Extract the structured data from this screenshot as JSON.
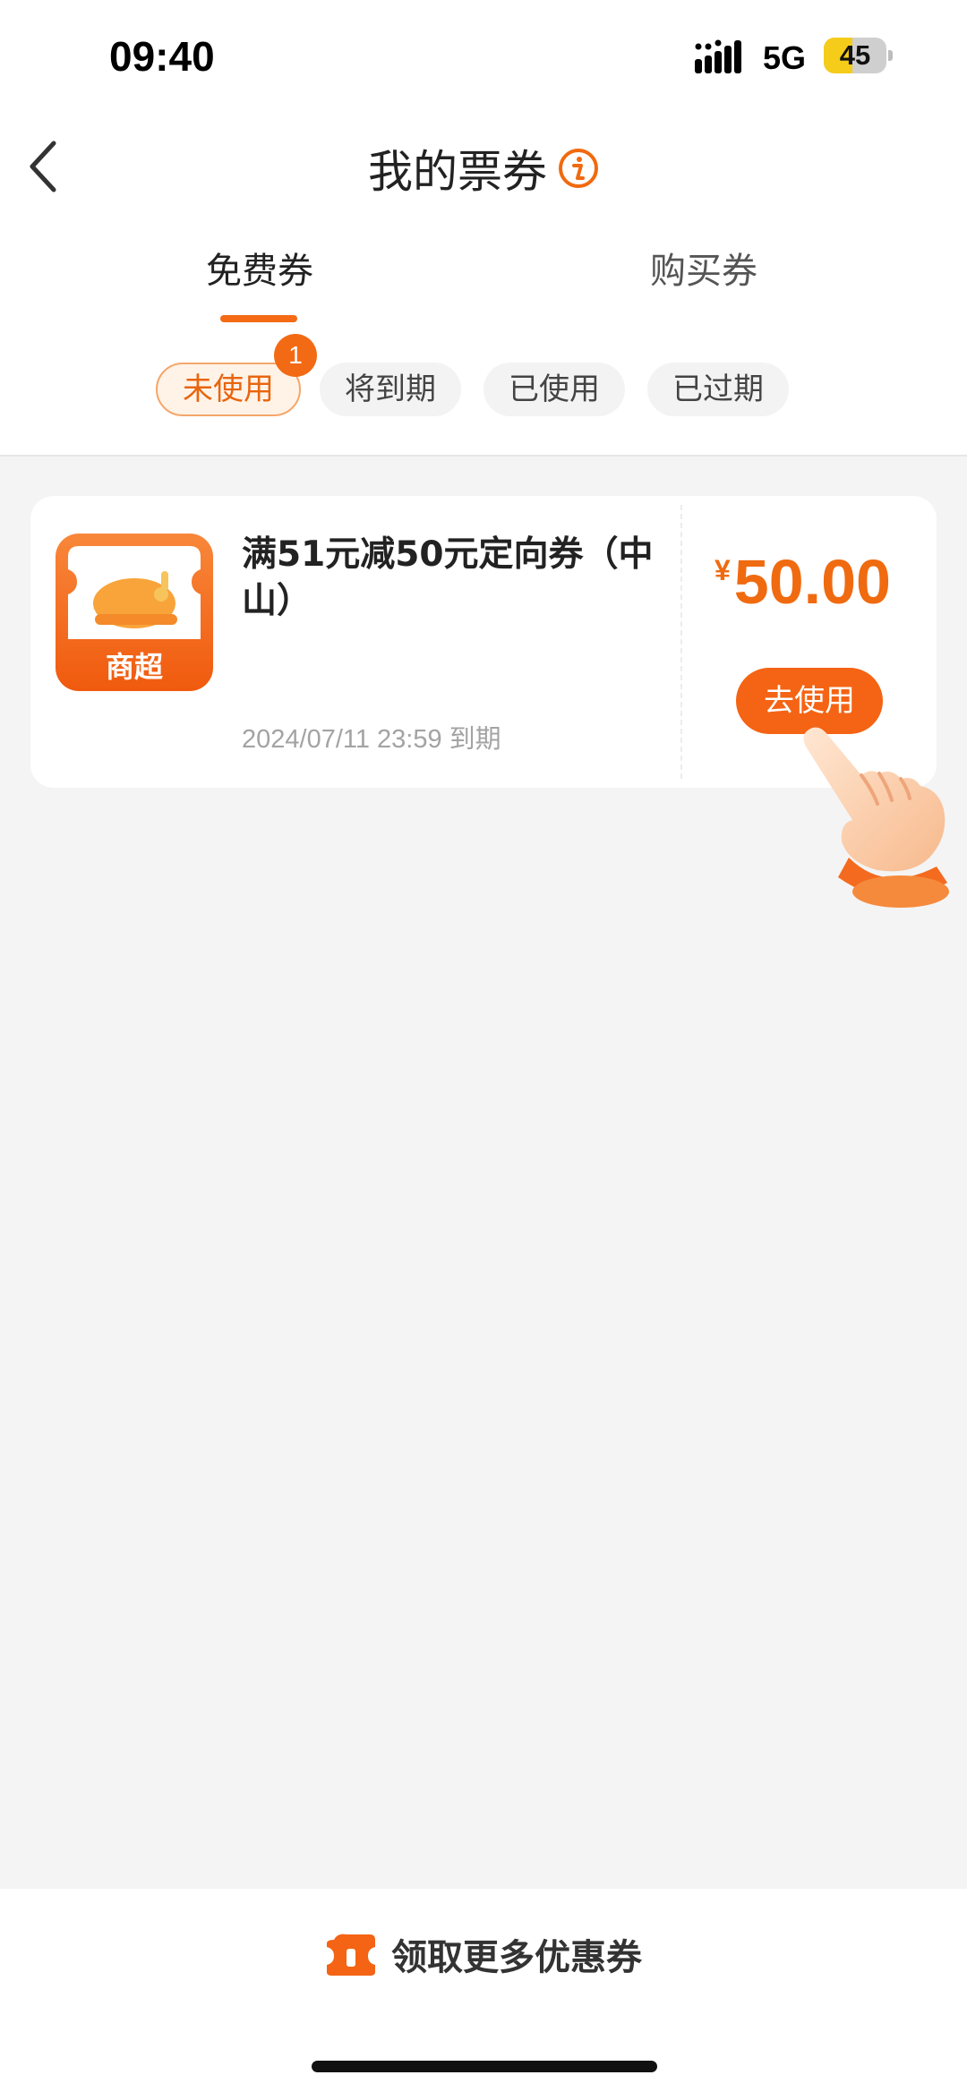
{
  "status_bar": {
    "time": "09:40",
    "network": "5G",
    "battery_level": "45",
    "battery_fraction": 0.45
  },
  "header": {
    "back_icon": "chevron-left-icon",
    "title": "我的票券",
    "info_icon": "info-icon"
  },
  "tabs": [
    {
      "label": "免费券",
      "active": true
    },
    {
      "label": "购买券",
      "active": false
    }
  ],
  "filters": [
    {
      "label": "未使用",
      "selected": true,
      "badge": "1"
    },
    {
      "label": "将到期",
      "selected": false
    },
    {
      "label": "已使用",
      "selected": false
    },
    {
      "label": "已过期",
      "selected": false
    }
  ],
  "coupons": [
    {
      "merchant_label": "商超",
      "title": "满51元减50元定向券（中山）",
      "expiry": "2024/07/11 23:59 到期",
      "currency": "¥",
      "amount": "50.00",
      "action_label": "去使用"
    }
  ],
  "bottom": {
    "icon": "ticket-icon",
    "label": "领取更多优惠券"
  },
  "colors": {
    "accent": "#f46414",
    "accent_light": "#fff3e8",
    "page_bg": "#f4f4f4"
  }
}
